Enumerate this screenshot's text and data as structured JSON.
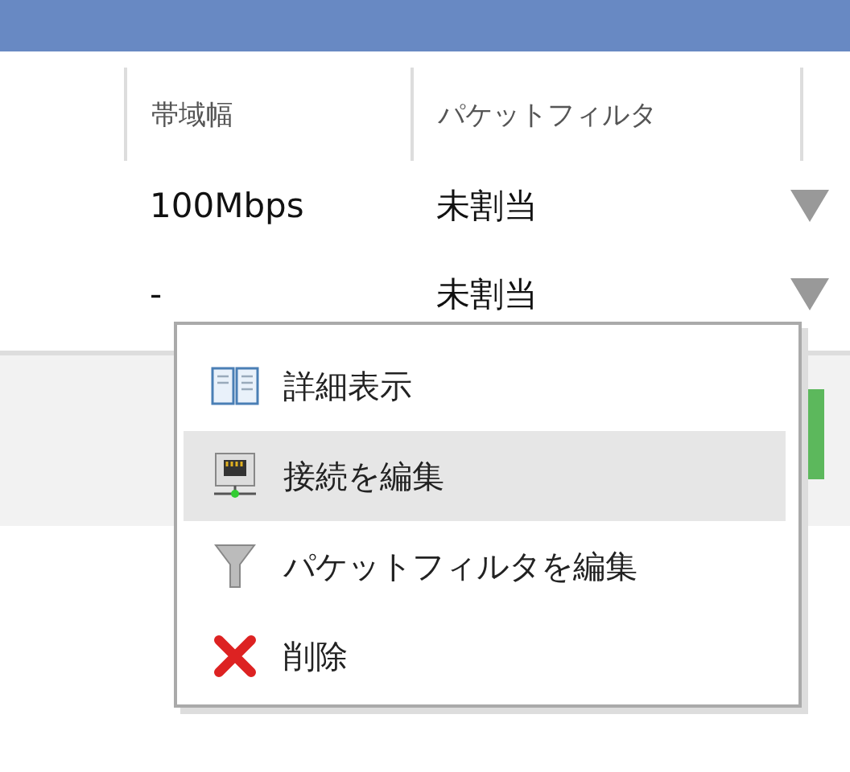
{
  "table": {
    "columns": [
      "帯域幅",
      "パケットフィルタ"
    ],
    "rows": [
      {
        "bandwidth": "100Mbps",
        "packet_filter": "未割当"
      },
      {
        "bandwidth": "-",
        "packet_filter": "未割当"
      }
    ]
  },
  "context_menu": {
    "items": [
      {
        "label": "詳細表示",
        "selected": false
      },
      {
        "label": "接続を編集",
        "selected": true
      },
      {
        "label": "パケットフィルタを編集",
        "selected": false
      },
      {
        "label": "削除",
        "selected": false
      }
    ]
  }
}
